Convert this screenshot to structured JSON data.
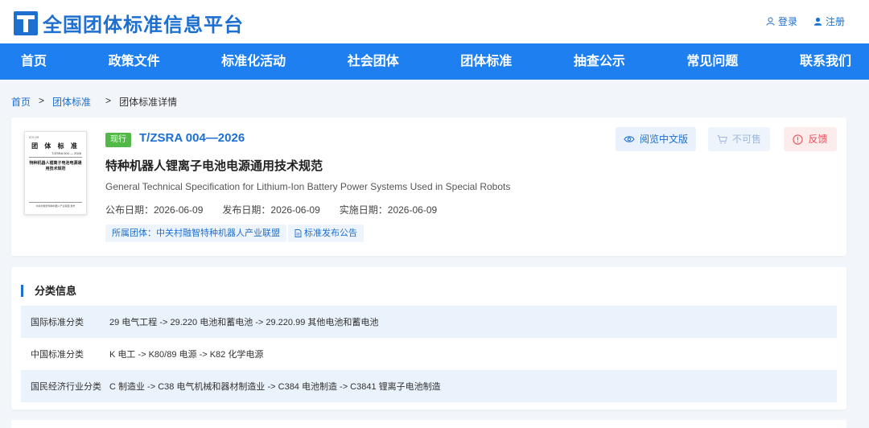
{
  "header": {
    "site_title": "全国团体标准信息平台",
    "login": "登录",
    "register": "注册"
  },
  "nav": {
    "items": [
      "首页",
      "政策文件",
      "标准化活动",
      "社会团体",
      "团体标准",
      "抽查公示",
      "常见问题",
      "联系我们"
    ]
  },
  "breadcrumb": {
    "home": "首页",
    "sep1": ">",
    "section": "团体标准",
    "sep2": ">",
    "current": "团体标准详情"
  },
  "standard": {
    "status": "现行",
    "code": "T/ZSRA 004—2026",
    "title_cn": "特种机器人锂离子电池电源通用技术规范",
    "title_en": "General Technical Specification for Lithium-Ion Battery Power Systems Used in Special Robots",
    "publish_date": "公布日期：2026-06-09",
    "release_date": "发布日期：2026-06-09",
    "effective_date": "实施日期：2026-06-09",
    "org_chip": "所属团体：中关村融智特种机器人产业联盟",
    "notice_chip": "标准发布公告",
    "thumbnail": {
      "head": "ICS  29",
      "title": "团 体 标 准",
      "code": "T/ZSRA 004 — 2026",
      "name": "特种机器人锂离子电池电源通用技术规范",
      "foot": "中关村融智特种机器人产业联盟  发布"
    }
  },
  "actions": {
    "read": "阅览中文版",
    "buy": "不可售",
    "feedback": "反馈"
  },
  "classification": {
    "section_title": "分类信息",
    "rows": [
      {
        "label": "国际标准分类",
        "value": "29 电气工程 -> 29.220 电池和蓄电池 -> 29.220.99 其他电池和蓄电池"
      },
      {
        "label": "中国标准分类",
        "value": "K 电工 -> K80/89 电源 -> K82 化学电源"
      },
      {
        "label": "国民经济行业分类",
        "value": "C 制造业 -> C38 电气机械和器材制造业 -> C384 电池制造 -> C3841 锂离子电池制造"
      }
    ]
  },
  "colors": {
    "brand_blue": "#1d6fd0",
    "nav_blue": "#1d7ff0",
    "status_green": "#52b948",
    "feedback_red": "#e8515a"
  }
}
